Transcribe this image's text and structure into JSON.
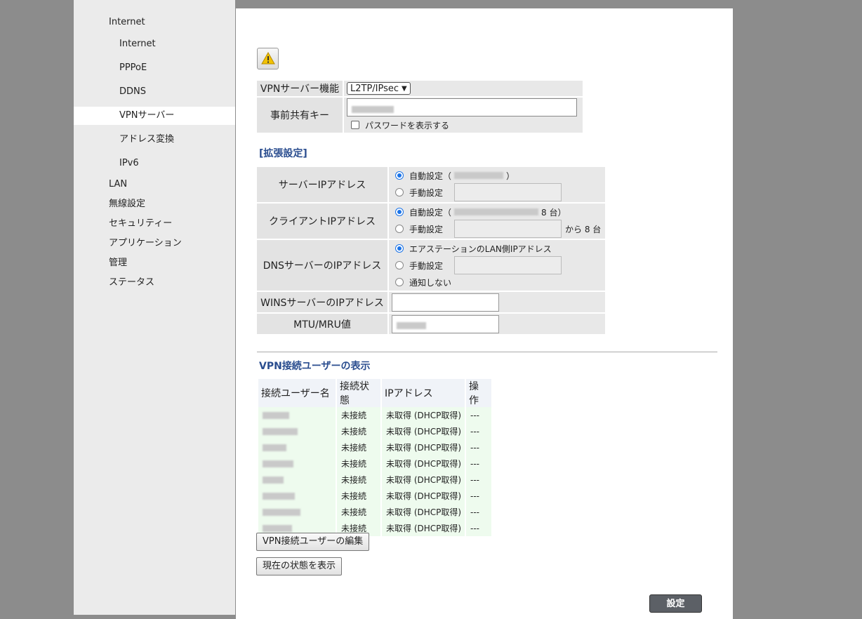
{
  "sidebar": {
    "items": [
      {
        "label": "Internet",
        "level": 1
      },
      {
        "label": "Internet",
        "level": 2
      },
      {
        "label": "PPPoE",
        "level": 2
      },
      {
        "label": "DDNS",
        "level": 2
      },
      {
        "label": "VPNサーバー",
        "level": 2,
        "active": true
      },
      {
        "label": "アドレス変換",
        "level": 2
      },
      {
        "label": "IPv6",
        "level": 2
      },
      {
        "label": "LAN",
        "level": 1
      },
      {
        "label": "無線設定",
        "level": 1
      },
      {
        "label": "セキュリティー",
        "level": 1
      },
      {
        "label": "アプリケーション",
        "level": 1
      },
      {
        "label": "管理",
        "level": 1
      },
      {
        "label": "ステータス",
        "level": 1
      }
    ]
  },
  "vpn": {
    "function_label": "VPNサーバー機能",
    "function_value": "L2TP/IPsec",
    "psk_label": "事前共有キー",
    "show_password_label": "パスワードを表示する"
  },
  "extended": {
    "heading": "[拡張設定]",
    "server_ip_label": "サーバーIPアドレス",
    "server_auto": "自動設定（",
    "server_auto_close": "）",
    "server_manual": "手動設定",
    "client_ip_label": "クライアントIPアドレス",
    "client_auto": "自動設定（",
    "client_auto_count": "8 台）",
    "client_manual": "手動設定",
    "client_manual_suffix": "から 8 台",
    "dns_label": "DNSサーバーのIPアドレス",
    "dns_opt1": "エアステーションのLAN側IPアドレス",
    "dns_opt2": "手動設定",
    "dns_opt3": "通知しない",
    "wins_label": "WINSサーバーのIPアドレス",
    "mtu_label": "MTU/MRU値"
  },
  "users": {
    "heading": "VPN接続ユーザーの表示",
    "columns": [
      "接続ユーザー名",
      "接続状態",
      "IPアドレス",
      "操作"
    ],
    "rows": [
      {
        "status": "未接続",
        "ip": "未取得 (DHCP取得)",
        "op": "---"
      },
      {
        "status": "未接続",
        "ip": "未取得 (DHCP取得)",
        "op": "---"
      },
      {
        "status": "未接続",
        "ip": "未取得 (DHCP取得)",
        "op": "---"
      },
      {
        "status": "未接続",
        "ip": "未取得 (DHCP取得)",
        "op": "---"
      },
      {
        "status": "未接続",
        "ip": "未取得 (DHCP取得)",
        "op": "---"
      },
      {
        "status": "未接続",
        "ip": "未取得 (DHCP取得)",
        "op": "---"
      },
      {
        "status": "未接続",
        "ip": "未取得 (DHCP取得)",
        "op": "---"
      },
      {
        "status": "未接続",
        "ip": "未取得 (DHCP取得)",
        "op": "---"
      }
    ]
  },
  "buttons": {
    "edit_users": "VPN接続ユーザーの編集",
    "show_status": "現在の状態を表示",
    "submit": "設定"
  }
}
